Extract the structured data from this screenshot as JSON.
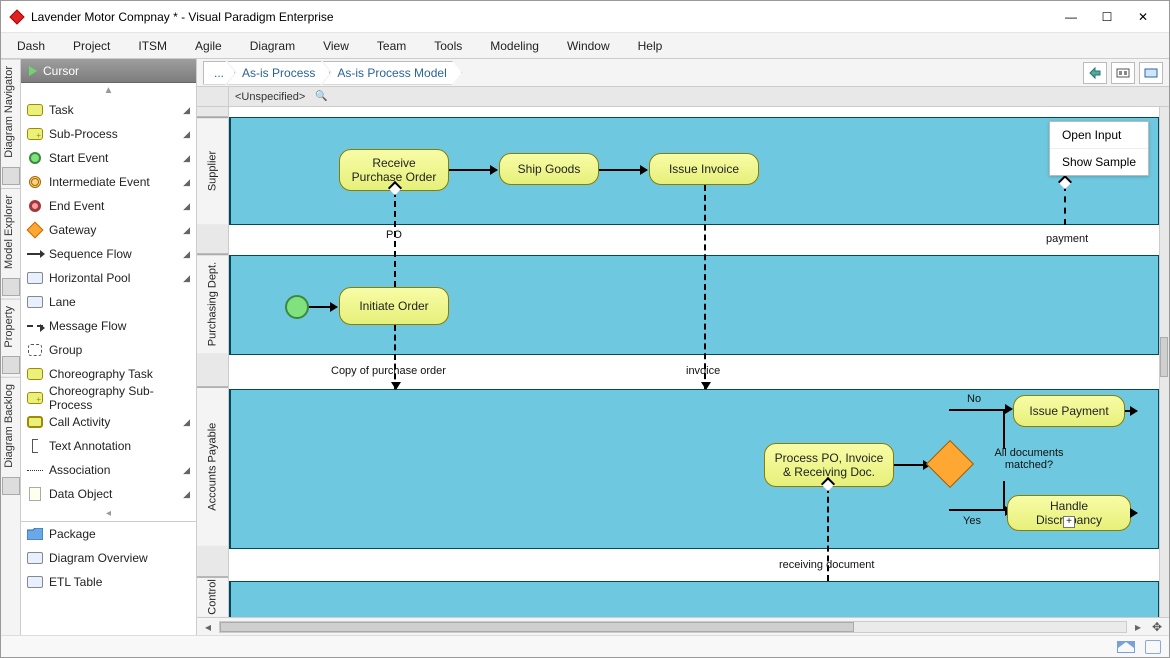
{
  "window": {
    "title": "Lavender Motor Compnay * - Visual Paradigm Enterprise"
  },
  "menu": {
    "items": [
      "Dash",
      "Project",
      "ITSM",
      "Agile",
      "Diagram",
      "View",
      "Team",
      "Tools",
      "Modeling",
      "Window",
      "Help"
    ]
  },
  "sidetabs": [
    "Diagram Navigator",
    "Model Explorer",
    "Property",
    "Diagram Backlog"
  ],
  "palette": {
    "cursor": "Cursor",
    "items": [
      "Task",
      "Sub-Process",
      "Start Event",
      "Intermediate Event",
      "End Event",
      "Gateway",
      "Sequence Flow",
      "Horizontal Pool",
      "Lane",
      "Message Flow",
      "Group",
      "Choreography Task",
      "Choreography Sub-Process",
      "Call Activity",
      "Text Annotation",
      "Association",
      "Data Object"
    ],
    "extras": [
      "Package",
      "Diagram Overview",
      "ETL Table"
    ]
  },
  "breadcrumbs": {
    "dots": "...",
    "b1": "As-is Process",
    "b2": "As-is Process Model"
  },
  "ruler": {
    "unspec": "<Unspecified>"
  },
  "pools": {
    "supplier": "Supplier",
    "purchasing": "Purchasing Dept.",
    "accounts": "Accounts Payable",
    "control": "Control"
  },
  "tasks": {
    "receive_po": "Receive Purchase Order",
    "ship_goods": "Ship Goods",
    "issue_invoice": "Issue Invoice",
    "initiate_order": "Initiate Order",
    "process_docs": "Process PO, Invoice & Receiving Doc.",
    "issue_payment": "Issue Payment",
    "handle_discrepancy": "Handle Discrepancy"
  },
  "labels": {
    "po": "PO",
    "copy_po": "Copy of purchase order",
    "invoice": "invoice",
    "payment": "payment",
    "receiving_doc": "receiving document",
    "gw_question": "All documents matched?",
    "no": "No",
    "yes": "Yes"
  },
  "floatbox": {
    "open_input": "Open Input",
    "show_sample": "Show Sample"
  }
}
